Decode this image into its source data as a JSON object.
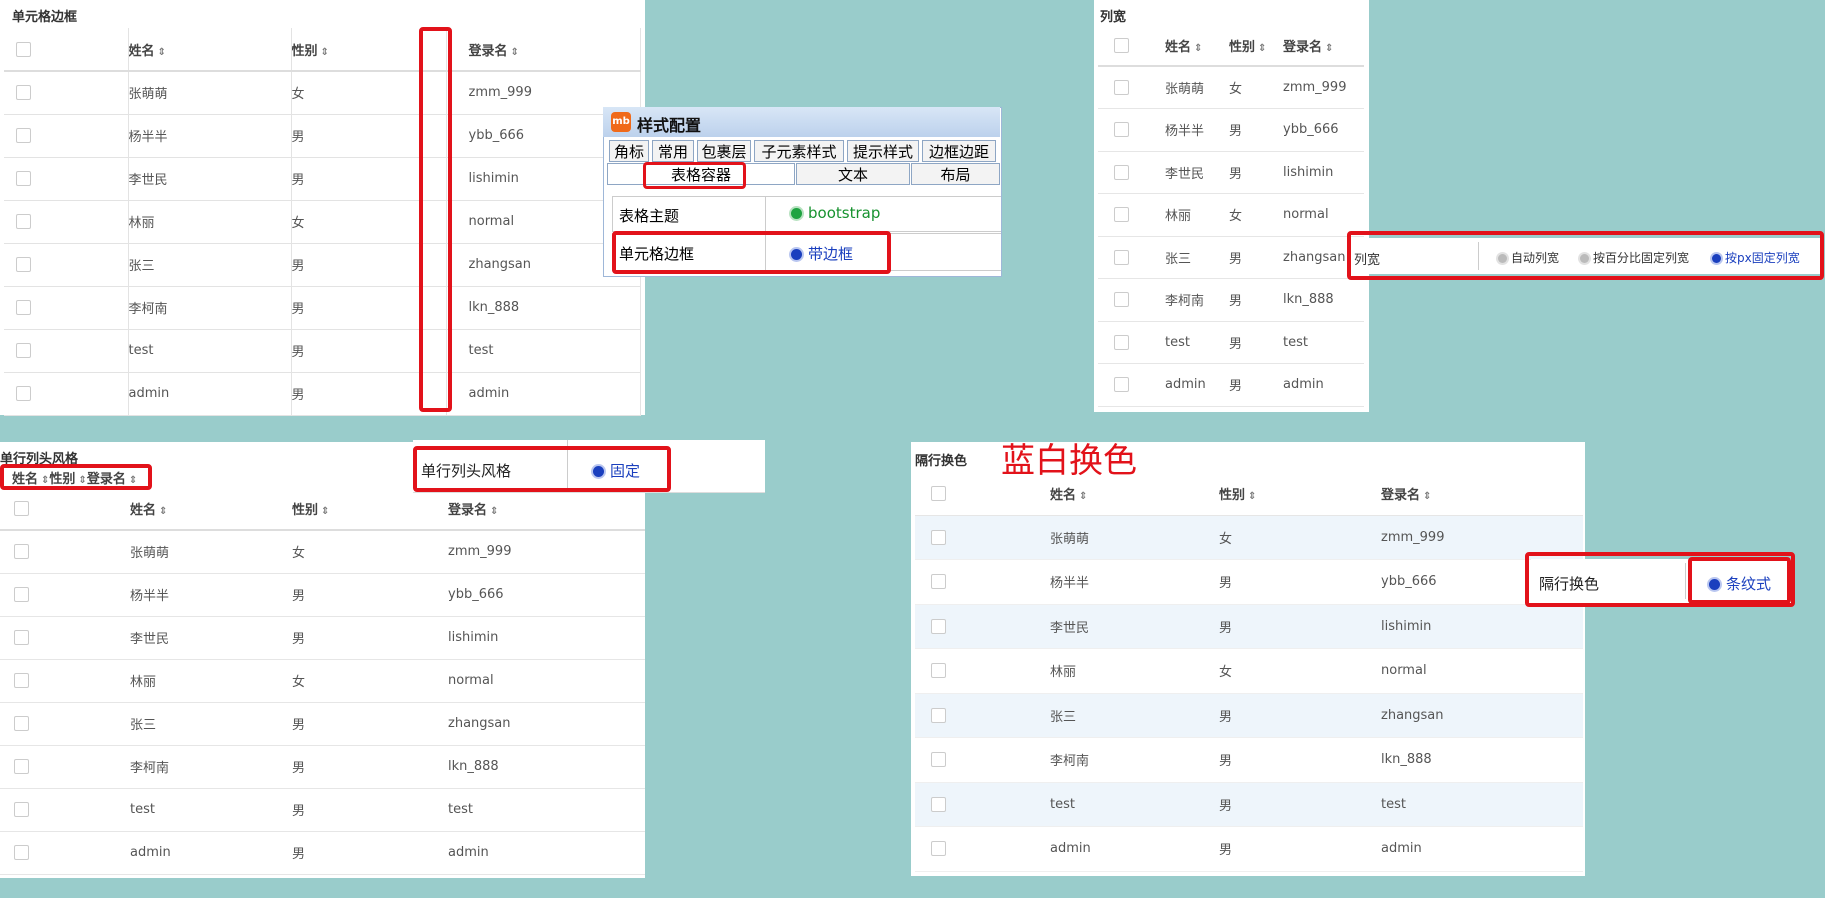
{
  "columns": [
    "姓名",
    "性别",
    "登录名"
  ],
  "rows": [
    [
      "张萌萌",
      "女",
      "zmm_999"
    ],
    [
      "杨半半",
      "男",
      "ybb_666"
    ],
    [
      "李世民",
      "男",
      "lishimin"
    ],
    [
      "林丽",
      "女",
      "normal"
    ],
    [
      "张三",
      "男",
      "zhangsan"
    ],
    [
      "李柯南",
      "男",
      "lkn_888"
    ],
    [
      "test",
      "男",
      "test"
    ],
    [
      "admin",
      "男",
      "admin"
    ]
  ],
  "sort_icon": "⇕",
  "panels": {
    "cell_border": {
      "title": "单元格边框"
    },
    "column_width": {
      "title": "列宽"
    },
    "header_style": {
      "title": "单行列头风格",
      "mini_header": [
        "姓名",
        "性别",
        "登录名"
      ]
    },
    "stripe": {
      "title": "隔行换色",
      "annotation": "蓝白换色"
    }
  },
  "style_config": {
    "window_title": "样式配置",
    "logo": "mb",
    "tabs_row1": [
      "角标",
      "常用",
      "包裹层",
      "子元素样式",
      "提示样式",
      "边框边距"
    ],
    "tabs_row2": [
      "表格容器",
      "文本",
      "布局"
    ],
    "rows": [
      {
        "label": "表格主题",
        "value": "bootstrap"
      },
      {
        "label": "单元格边框",
        "value": "带边框"
      }
    ]
  },
  "column_width_config": {
    "label": "列宽",
    "options": [
      "自动列宽",
      "按百分比固定列宽",
      "按px固定列宽"
    ]
  },
  "header_style_config": {
    "label": "单行列头风格",
    "value": "固定"
  },
  "stripe_config": {
    "label": "隔行换色",
    "value": "条纹式"
  },
  "colors": {
    "accent_red": "#e2121a",
    "radio_blue": "#1a3fbe",
    "radio_green": "#1fa341",
    "background": "#99cccb",
    "stripe": "#eef5fb"
  }
}
